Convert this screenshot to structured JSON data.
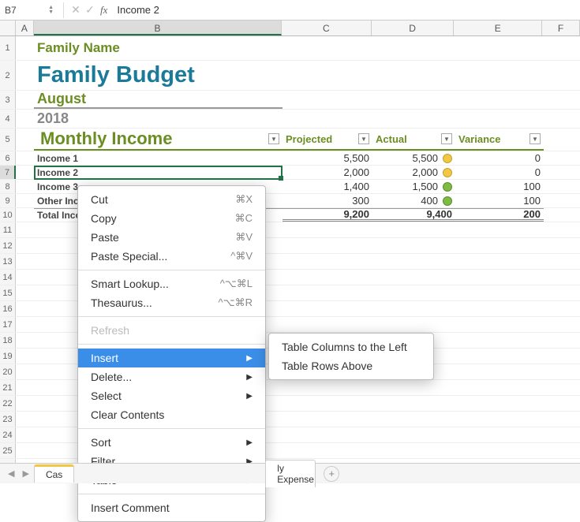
{
  "formula_bar": {
    "cell_ref": "B7",
    "value": "Income 2"
  },
  "columns": [
    "A",
    "B",
    "C",
    "D",
    "E",
    "F"
  ],
  "header": {
    "family_name": "Family Name",
    "title": "Family Budget",
    "month": "August",
    "year": "2018",
    "section": "Monthly Income"
  },
  "table": {
    "col_projected": "Projected",
    "col_actual": "Actual",
    "col_variance": "Variance",
    "rows": [
      {
        "label": "Income 1",
        "projected": "5,500",
        "actual": "5,500",
        "variance": "0",
        "dot": "Y"
      },
      {
        "label": "Income 2",
        "projected": "2,000",
        "actual": "2,000",
        "variance": "0",
        "dot": "Y"
      },
      {
        "label": "Income 3",
        "projected": "1,400",
        "actual": "1,500",
        "variance": "100",
        "dot": "G"
      },
      {
        "label": "Other Income",
        "projected": "300",
        "actual": "400",
        "variance": "100",
        "dot": "G"
      }
    ],
    "total": {
      "label": "Total Income",
      "projected": "9,200",
      "actual": "9,400",
      "variance": "200"
    }
  },
  "context_menu": {
    "cut": "Cut",
    "cut_sc": "⌘X",
    "copy": "Copy",
    "copy_sc": "⌘C",
    "paste": "Paste",
    "paste_sc": "⌘V",
    "paste_special": "Paste Special...",
    "paste_special_sc": "^⌘V",
    "smart_lookup": "Smart Lookup...",
    "smart_sc": "^⌥⌘L",
    "thesaurus": "Thesaurus...",
    "thesaurus_sc": "^⌥⌘R",
    "refresh": "Refresh",
    "insert": "Insert",
    "delete": "Delete...",
    "select": "Select",
    "clear": "Clear Contents",
    "sort": "Sort",
    "filter": "Filter",
    "table": "Table",
    "comment": "Insert Comment"
  },
  "insert_submenu": {
    "cols_left": "Table Columns to the Left",
    "rows_above": "Table Rows Above"
  },
  "sheet_tabs": {
    "tab1": "Cas",
    "tab2": "ly Expense",
    "add": "+"
  }
}
